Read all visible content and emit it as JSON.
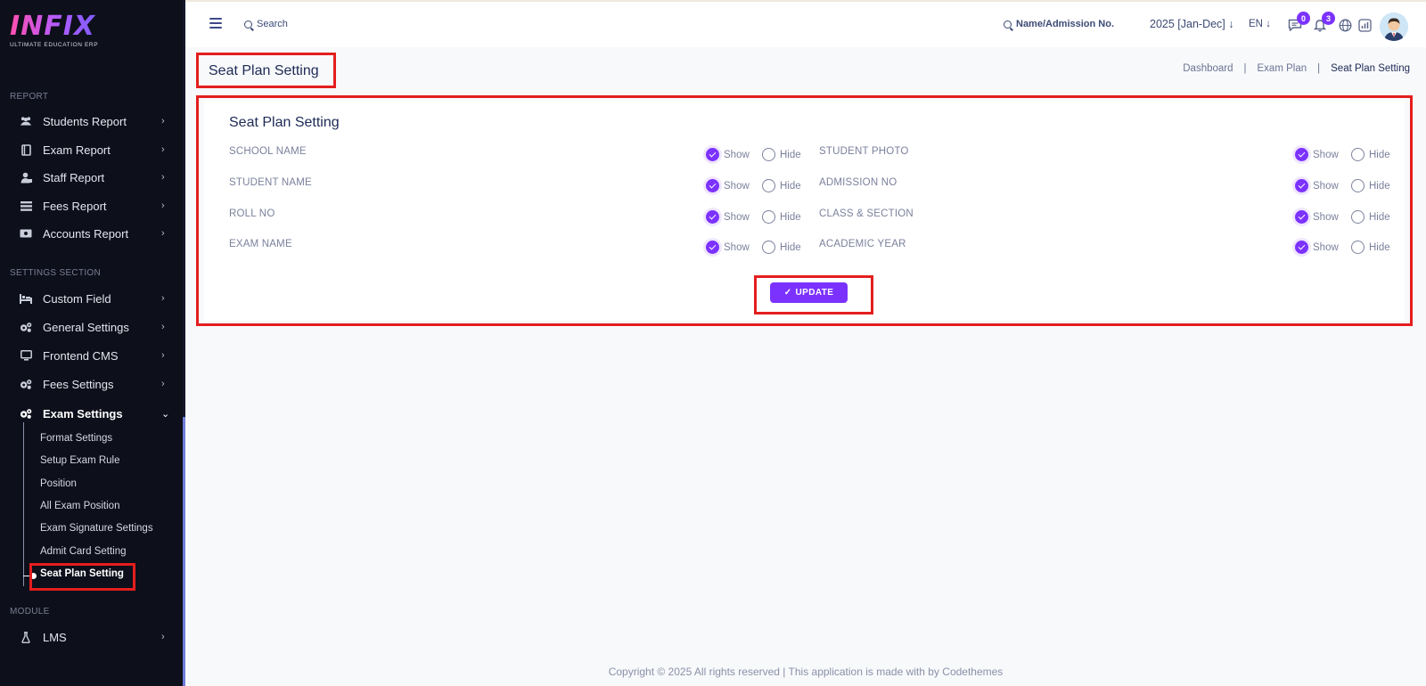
{
  "brand": {
    "logo_text": "INFIX",
    "tagline": "ULTIMATE EDUCATION ERP"
  },
  "sidebar": {
    "sections": [
      {
        "label": "REPORT"
      },
      {
        "label": "SETTINGS SECTION"
      },
      {
        "label": "MODULE"
      }
    ],
    "report_items": [
      {
        "label": "Students Report",
        "icon": "users-icon"
      },
      {
        "label": "Exam Report",
        "icon": "book-icon"
      },
      {
        "label": "Staff Report",
        "icon": "user-tie-icon"
      },
      {
        "label": "Fees Report",
        "icon": "list-icon"
      },
      {
        "label": "Accounts Report",
        "icon": "money-icon"
      }
    ],
    "settings_items": [
      {
        "label": "Custom Field",
        "icon": "bed-icon"
      },
      {
        "label": "General Settings",
        "icon": "gears-icon"
      },
      {
        "label": "Frontend CMS",
        "icon": "monitor-icon"
      },
      {
        "label": "Fees Settings",
        "icon": "gears-icon"
      },
      {
        "label": "Exam Settings",
        "icon": "gears-icon"
      }
    ],
    "exam_sub_items": [
      {
        "label": "Format Settings"
      },
      {
        "label": "Setup Exam Rule"
      },
      {
        "label": "Position"
      },
      {
        "label": "All Exam Position"
      },
      {
        "label": "Exam Signature Settings"
      },
      {
        "label": "Admit Card Setting"
      },
      {
        "label": "Seat Plan Setting"
      }
    ],
    "module_items": [
      {
        "label": "LMS",
        "icon": "flask-icon"
      }
    ]
  },
  "topbar": {
    "search_placeholder": "Search",
    "student_search_placeholder": "Name/Admission No.",
    "academic_year": "2025 [Jan-Dec]",
    "language": "EN",
    "message_count": "0",
    "notification_count": "3"
  },
  "page": {
    "title": "Seat Plan Setting",
    "breadcrumb": [
      "Dashboard",
      "Exam Plan",
      "Seat Plan Setting"
    ]
  },
  "panel": {
    "title": "Seat Plan Setting",
    "show_label": "Show",
    "hide_label": "Hide",
    "left_fields": [
      {
        "label": "SCHOOL NAME",
        "value": "Show"
      },
      {
        "label": "STUDENT NAME",
        "value": "Show"
      },
      {
        "label": "ROLL NO",
        "value": "Show"
      },
      {
        "label": "EXAM NAME",
        "value": "Show"
      }
    ],
    "right_fields": [
      {
        "label": "STUDENT PHOTO",
        "value": "Show"
      },
      {
        "label": "ADMISSION NO",
        "value": "Show"
      },
      {
        "label": "CLASS & SECTION",
        "value": "Show"
      },
      {
        "label": "ACADEMIC YEAR",
        "value": "Show"
      }
    ],
    "update_label": "UPDATE"
  },
  "footer": {
    "text": "Copyright © 2025 All rights reserved | This application is made with by Codethemes"
  },
  "colors": {
    "accent": "#7c32ff",
    "sidebar_bg": "#0d0f1a",
    "highlight": "#e41e1e",
    "heading": "#1d2a55"
  }
}
